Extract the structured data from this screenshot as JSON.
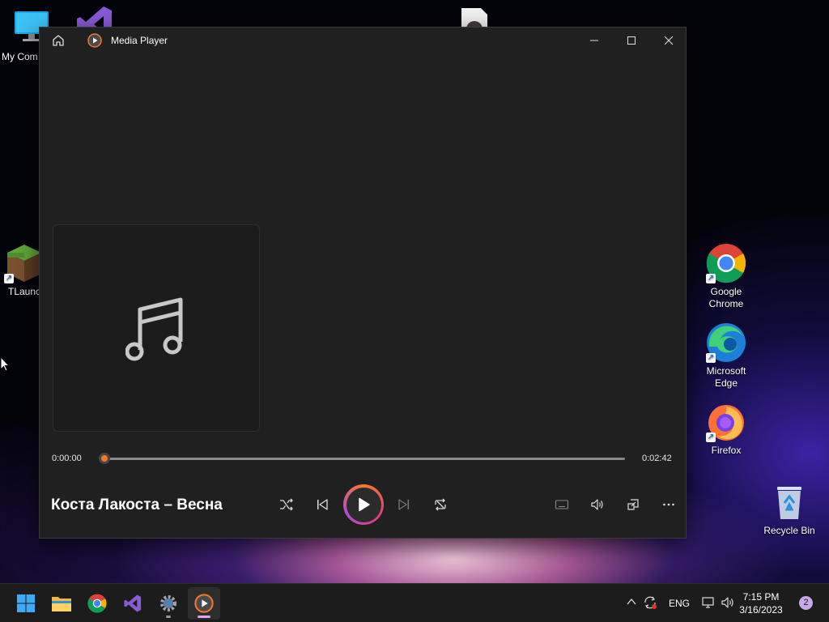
{
  "desktop": {
    "icons": [
      {
        "label": "My Com",
        "icon": "computer-icon"
      },
      {
        "label": "",
        "icon": "visual-studio-icon"
      },
      {
        "label": "",
        "icon": "media-file-icon"
      },
      {
        "label": "TLaunc",
        "icon": "minecraft-tlauncher-icon"
      },
      {
        "label": "Google Chrome",
        "icon": "chrome-icon"
      },
      {
        "label": "Microsoft Edge",
        "icon": "edge-icon"
      },
      {
        "label": "Firefox",
        "icon": "firefox-icon"
      },
      {
        "label": "Recycle Bin",
        "icon": "recycle-bin-icon"
      }
    ]
  },
  "window": {
    "title": "Media Player",
    "controls": [
      "minimize-icon",
      "maximize-icon",
      "close-icon"
    ]
  },
  "player": {
    "elapsed": "0:00:00",
    "duration": "0:02:42",
    "progress": 0,
    "track_title": "Коста Лакоста – Весна",
    "album_art_icon": "music-note-icon",
    "controls": [
      "shuffle-icon",
      "previous-icon",
      "play-icon",
      "next-icon",
      "repeat-icon"
    ],
    "right_controls": [
      "miniplayer-icon",
      "volume-icon",
      "cast-icon",
      "more-icon"
    ]
  },
  "taskbar": {
    "apps": [
      "start-icon",
      "file-explorer-icon",
      "chrome-icon",
      "visual-studio-icon",
      "settings-icon",
      "media-player-icon"
    ],
    "language": "ENG",
    "time": "7:15 PM",
    "date": "3/16/2023",
    "notification_count": "2"
  },
  "colors": {
    "accent_orange": "#f07a2a",
    "accent_pink": "#e0407a",
    "window_bg": "#202020",
    "taskbar_bg": "#1c1c1c"
  }
}
